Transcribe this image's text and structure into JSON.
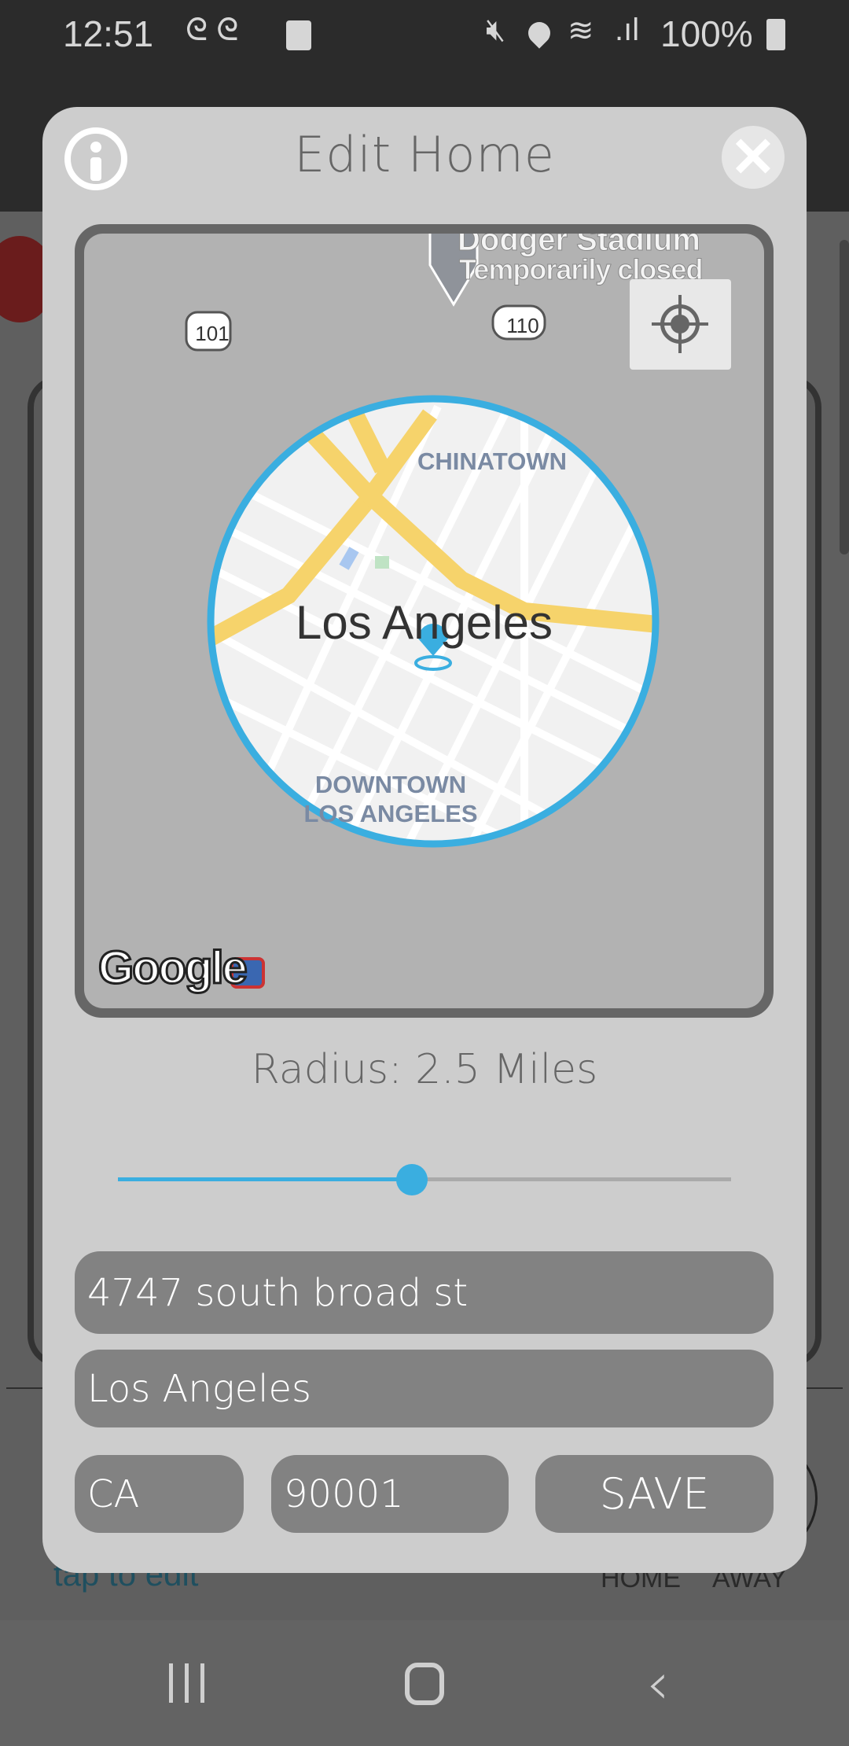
{
  "status_bar": {
    "time": "12:51",
    "battery": "100%",
    "icons": [
      "notification-swirl-icon",
      "notification-swirl-icon",
      "clock-app-icon",
      "mute-icon",
      "location-icon",
      "wifi-icon",
      "signal-icon",
      "battery-icon"
    ]
  },
  "background": {
    "tap_to_edit": "tap to edit",
    "home_label": "HOME",
    "away_label": "AWAY"
  },
  "dialog": {
    "title": "Edit Home",
    "info_icon": "info-icon",
    "close_icon": "close-icon",
    "map": {
      "poi_name": "Dodger Stadium",
      "poi_status": "Temporarily closed",
      "shield_101": "101",
      "shield_110": "110",
      "neighborhood_1": "CHINATOWN",
      "city": "Los Angeles",
      "neighborhood_2a": "DOWNTOWN",
      "neighborhood_2b": "LOS ANGELES",
      "provider": "Google",
      "accent": "#3aaee0"
    },
    "radius_label": "Radius: 2.5 Miles",
    "radius_value": 2.5,
    "slider_fraction": 0.48,
    "street": "4747 south broad st",
    "city": "Los Angeles",
    "state": "CA",
    "zip": "90001",
    "save_label": "SAVE"
  },
  "nav": {
    "recents_icon": "recents-icon",
    "home_icon": "home-icon",
    "back_icon": "back-icon"
  }
}
